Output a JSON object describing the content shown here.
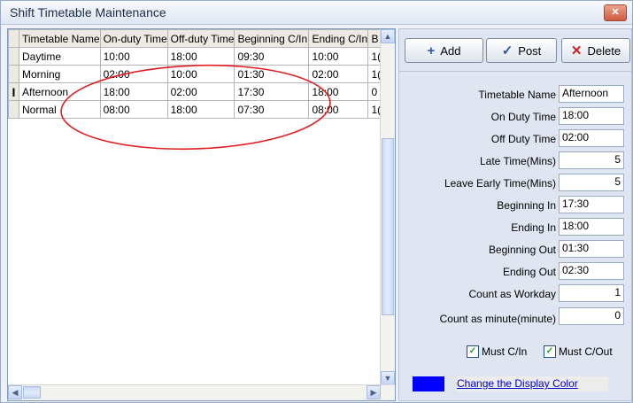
{
  "window": {
    "title": "Shift Timetable Maintenance",
    "close_glyph": "✕"
  },
  "grid": {
    "columns": [
      "Timetable Name",
      "On-duty Time",
      "Off-duty Time",
      "Beginning C/In",
      "Ending C/In",
      "B"
    ],
    "rows": [
      {
        "indicator": "",
        "cells": [
          "Daytime",
          "10:00",
          "18:00",
          "09:30",
          "10:00",
          "1("
        ]
      },
      {
        "indicator": "",
        "cells": [
          "Morning",
          "02:00",
          "10:00",
          "01:30",
          "02:00",
          "1("
        ]
      },
      {
        "indicator": "I",
        "cells": [
          "Afternoon",
          "18:00",
          "02:00",
          "17:30",
          "18:00",
          "0"
        ]
      },
      {
        "indicator": "",
        "cells": [
          "Normal",
          "08:00",
          "18:00",
          "07:30",
          "08:00",
          "1("
        ]
      }
    ],
    "annotation": {
      "shape": "ellipse",
      "color": "#e02020"
    }
  },
  "toolbar": {
    "add_label": "Add",
    "add_icon": "+",
    "post_label": "Post",
    "post_icon": "✓",
    "delete_label": "Delete",
    "delete_icon": "✕"
  },
  "form": {
    "timetable_name": {
      "label": "Timetable Name",
      "value": "Afternoon"
    },
    "on_duty_time": {
      "label": "On Duty Time",
      "value": "18:00"
    },
    "off_duty_time": {
      "label": "Off Duty Time",
      "value": "02:00"
    },
    "late_time": {
      "label": "Late Time(Mins)",
      "value": "5"
    },
    "leave_early_time": {
      "label": "Leave Early Time(Mins)",
      "value": "5"
    },
    "beginning_in": {
      "label": "Beginning In",
      "value": "17:30"
    },
    "ending_in": {
      "label": "Ending In",
      "value": "18:00"
    },
    "beginning_out": {
      "label": "Beginning Out",
      "value": "01:30"
    },
    "ending_out": {
      "label": "Ending Out",
      "value": "02:30"
    },
    "count_as_workday": {
      "label": "Count as Workday",
      "value": "1"
    },
    "count_as_minute": {
      "label": "Count as minute(minute)",
      "value": "0"
    }
  },
  "checkboxes": {
    "must_cin": {
      "label": "Must C/In",
      "checked": true
    },
    "must_cout": {
      "label": "Must C/Out",
      "checked": true
    }
  },
  "display_color": {
    "color": "#0000ff",
    "link_label": "Change the Display Color"
  },
  "icons": {
    "scroll_up": "▲",
    "scroll_down": "▼",
    "scroll_left": "◀",
    "scroll_right": "▶",
    "check_mark": "✓"
  }
}
